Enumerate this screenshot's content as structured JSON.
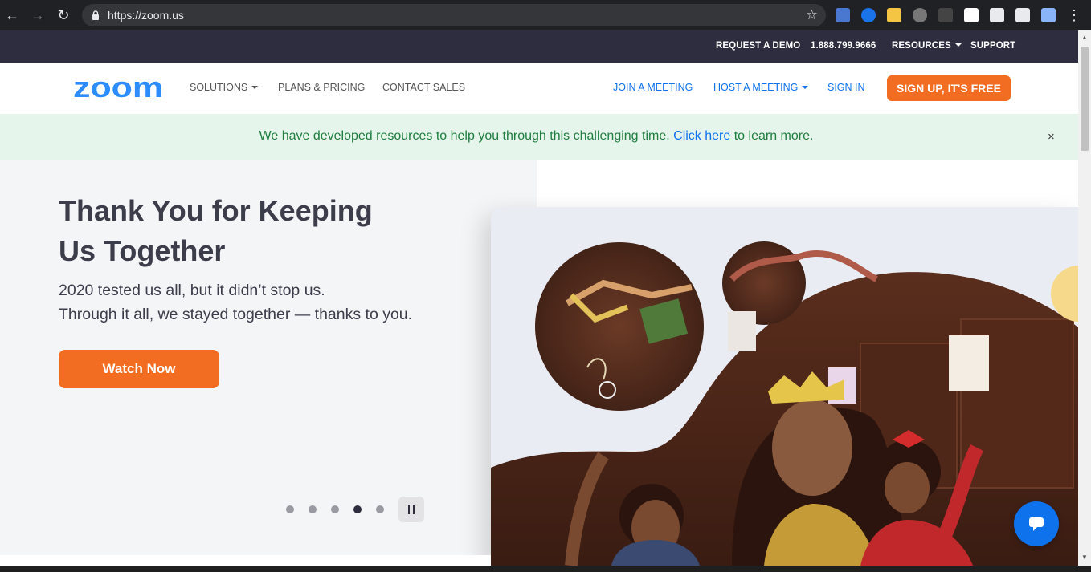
{
  "browser": {
    "url": "https://zoom.us",
    "back_icon": "back-arrow-icon",
    "forward_icon": "forward-arrow-icon",
    "reload_icon": "reload-icon",
    "menu_icon": "more-vert-icon"
  },
  "utility_bar": {
    "request_demo": "REQUEST A DEMO",
    "phone": "1.888.799.9666",
    "resources": "RESOURCES",
    "support": "SUPPORT"
  },
  "nav": {
    "logo": "zoom",
    "solutions": "SOLUTIONS",
    "plans_pricing": "PLANS & PRICING",
    "contact_sales": "CONTACT SALES",
    "join_meeting": "JOIN A MEETING",
    "host_meeting": "HOST A MEETING",
    "sign_in": "SIGN IN",
    "sign_up": "SIGN UP, IT'S FREE"
  },
  "banner": {
    "text": "We have developed resources to help you through this challenging time.",
    "link": "Click here",
    "rest": "to learn more.",
    "close": "×"
  },
  "hero": {
    "title": "Thank You for Keeping Us Together",
    "subtitle_line1": "2020 tested us all, but it didn’t stop us.",
    "subtitle_line2": "Through it all, we stayed together — thanks to you.",
    "cta": "Watch Now",
    "slide_count": 5,
    "active_slide": 4
  },
  "colors": {
    "brand_blue": "#0e72ed",
    "brand_orange": "#f26d21",
    "dark_bar": "#2d2d3f",
    "banner_green": "#1f7d3e"
  }
}
